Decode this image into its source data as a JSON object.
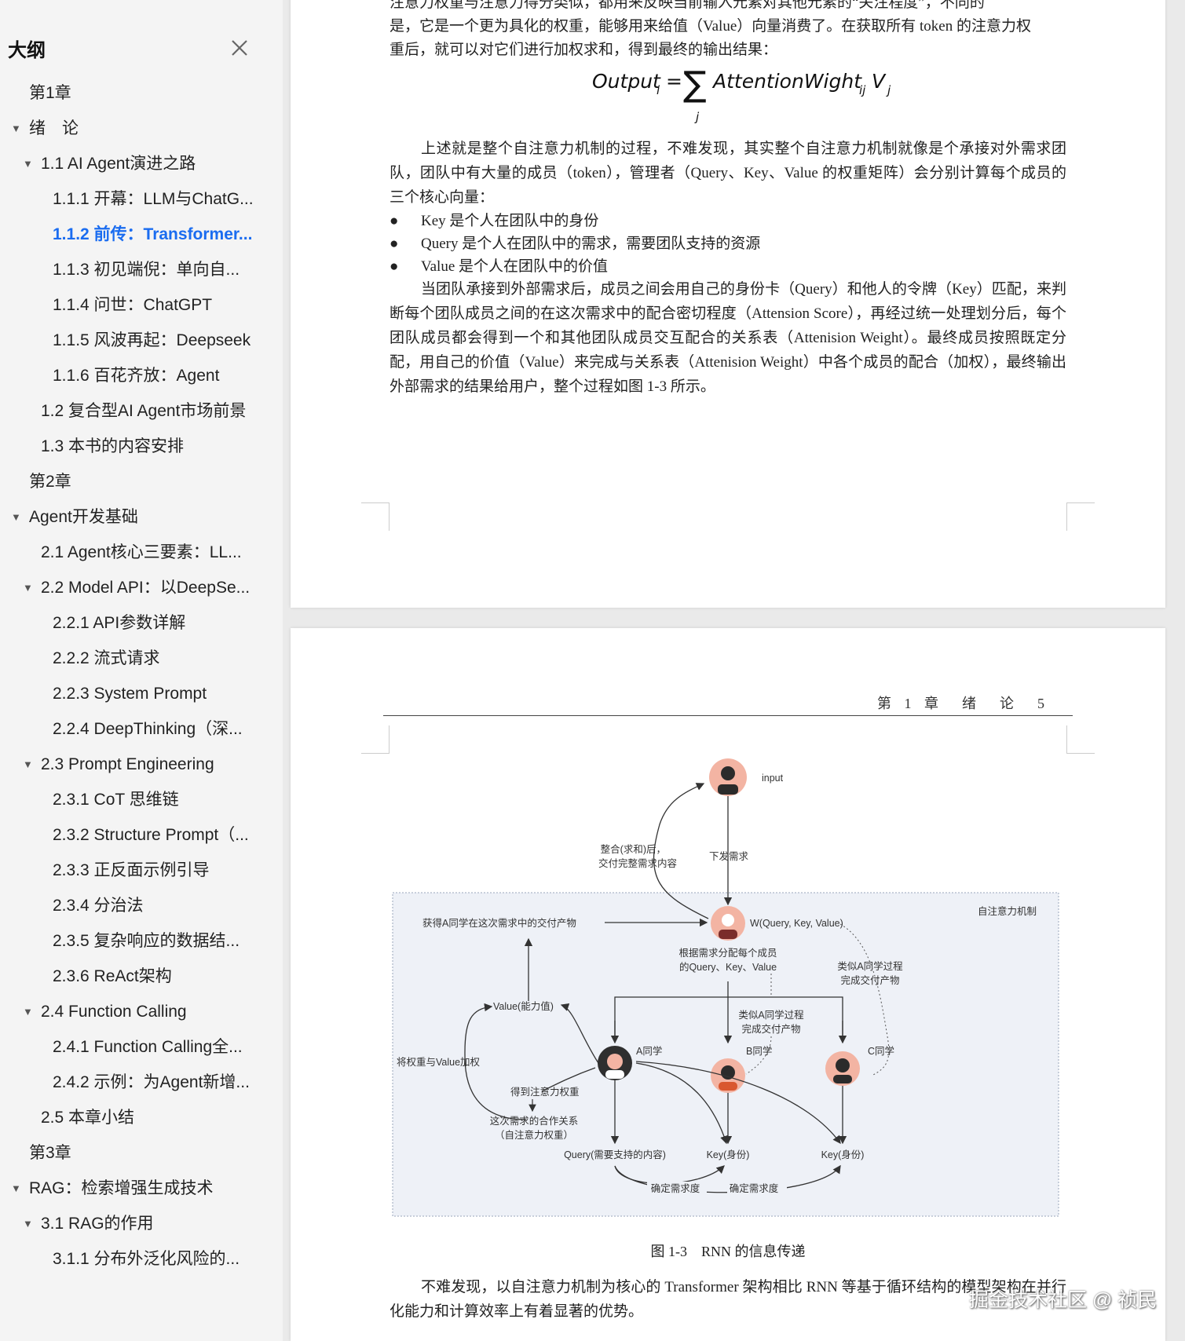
{
  "sidebar": {
    "title": "大纲",
    "items": [
      {
        "label": "第1章",
        "level": 1,
        "arrow": ""
      },
      {
        "label": "绪　论",
        "level": 1,
        "arrow": "▼"
      },
      {
        "label": "1.1  AI Agent演进之路",
        "level": 2,
        "arrow": "▼"
      },
      {
        "label": "1.1.1  开幕：LLM与ChatG...",
        "level": 3,
        "arrow": ""
      },
      {
        "label": "1.1.2  前传：Transformer...",
        "level": 3,
        "arrow": "",
        "active": true
      },
      {
        "label": "1.1.3  初见端倪：单向自...",
        "level": 3,
        "arrow": ""
      },
      {
        "label": "1.1.4  问世：ChatGPT",
        "level": 3,
        "arrow": ""
      },
      {
        "label": "1.1.5  风波再起：Deepseek",
        "level": 3,
        "arrow": ""
      },
      {
        "label": "1.1.6  百花齐放：Agent",
        "level": 3,
        "arrow": ""
      },
      {
        "label": "1.2  复合型AI Agent市场前景",
        "level": 2,
        "arrow": ""
      },
      {
        "label": "1.3  本书的内容安排",
        "level": 2,
        "arrow": ""
      },
      {
        "label": "第2章",
        "level": 1,
        "arrow": ""
      },
      {
        "label": "Agent开发基础",
        "level": 1,
        "arrow": "▼"
      },
      {
        "label": "2.1  Agent核心三要素：LL...",
        "level": 2,
        "arrow": ""
      },
      {
        "label": "2.2  Model API：以DeepSe...",
        "level": 2,
        "arrow": "▼"
      },
      {
        "label": "2.2.1  API参数详解",
        "level": 3,
        "arrow": ""
      },
      {
        "label": "2.2.2  流式请求",
        "level": 3,
        "arrow": ""
      },
      {
        "label": "2.2.3  System Prompt",
        "level": 3,
        "arrow": ""
      },
      {
        "label": "2.2.4  DeepThinking（深...",
        "level": 3,
        "arrow": ""
      },
      {
        "label": "2.3  Prompt Engineering",
        "level": 2,
        "arrow": "▼"
      },
      {
        "label": "2.3.1  CoT 思维链",
        "level": 3,
        "arrow": ""
      },
      {
        "label": "2.3.2  Structure Prompt（...",
        "level": 3,
        "arrow": ""
      },
      {
        "label": "2.3.3  正反面示例引导",
        "level": 3,
        "arrow": ""
      },
      {
        "label": "2.3.4  分治法",
        "level": 3,
        "arrow": ""
      },
      {
        "label": "2.3.5  复杂响应的数据结...",
        "level": 3,
        "arrow": ""
      },
      {
        "label": "2.3.6  ReAct架构",
        "level": 3,
        "arrow": ""
      },
      {
        "label": "2.4  Function Calling",
        "level": 2,
        "arrow": "▼"
      },
      {
        "label": "2.4.1  Function Calling全...",
        "level": 3,
        "arrow": ""
      },
      {
        "label": "2.4.2  示例：为Agent新增...",
        "level": 3,
        "arrow": ""
      },
      {
        "label": "2.5  本章小结",
        "level": 2,
        "arrow": ""
      },
      {
        "label": "第3章",
        "level": 1,
        "arrow": ""
      },
      {
        "label": "RAG：检索增强生成技术",
        "level": 1,
        "arrow": "▼"
      },
      {
        "label": "3.1  RAG的作用",
        "level": 2,
        "arrow": "▼"
      },
      {
        "label": "3.1.1  分布外泛化风险的...",
        "level": 3,
        "arrow": ""
      }
    ]
  },
  "page1": {
    "p_top_1": "注意力权重与注意力得分类似，都用来反映当前输入元素对其他元素的“关注程度”，不同的",
    "p_top_2": "是，它是一个更为具化的权重，能够用来给值（Value）向量消费了。在获取所有 token 的注意力权",
    "p_top_3": "重后，就可以对它们进行加权求和，得到最终的输出结果：",
    "formula": {
      "lhs": "Output",
      "lhs_sub": "i",
      "eq": "=",
      "sum": "∑",
      "sum_sub": "j",
      "rhs": "AttentionWight",
      "rhs_sub": "ij",
      "v": "V",
      "v_sub": "j"
    },
    "p_middle": "上述就是整个自注意力机制的过程，不难发现，其实整个自注意力机制就像是个承接对外需求团队，团队中有大量的成员（token），管理者（Query、Key、Value 的权重矩阵）会分别计算每个成员的三个核心向量：",
    "bullets": [
      "Key 是个人在团队中的身份",
      "Query 是个人在团队中的需求，需要团队支持的资源",
      "Value 是个人在团队中的价值"
    ],
    "p_last": "当团队承接到外部需求后，成员之间会用自己的身份卡（Query）和他人的令牌（Key）匹配，来判断每个团队成员之间的在这次需求中的配合密切程度（Attension Score），再经过统一处理划分后，每个团队成员都会得到一个和其他团队成员交互配合的关系表（Attenision Weight）。最终成员按照既定分配，用自己的价值（Value）来完成与关系表（Attenision Weight）中各个成员的配合（加权），最终输出外部需求的结果给用户，整个过程如图 1-3 所示。"
  },
  "page2": {
    "running_head": "第 1 章　绪　论　5",
    "figure_caption": "图 1-3　RNN 的信息传递",
    "p_bottom": "不难发现，以自注意力机制为核心的 Transformer 架构相比 RNN 等基于循环结构的模型架构在并行化能力和计算效率上有着显著的优势。"
  },
  "diagram": {
    "input": "input",
    "integrate_1": "整合(求和)后，",
    "integrate_2": "交付完整需求内容",
    "dispatch": "下发需求",
    "box_title": "自注意力机制",
    "get_a_output": "获得A同学在这次需求中的交付产物",
    "w_label": "W(Query, Key, Value)",
    "assign_1": "根据需求分配每个成员",
    "assign_2": "的Query、Key、Value",
    "similar_c_1": "类似A同学过程",
    "similar_c_2": "完成交付产物",
    "similar_b_1": "类似A同学过程",
    "similar_b_2": "完成交付产物",
    "value_label": "Value(能力值)",
    "weight_value": "将权重与Value加权",
    "student_a": "A同学",
    "student_b": "B同学",
    "student_c": "C同学",
    "get_weight": "得到注意力权重",
    "relation_1": "这次需求的合作关系",
    "relation_2": "（自注意力权重）",
    "query_label": "Query(需要支持的内容)",
    "key_b": "Key(身份)",
    "key_c": "Key(身份)",
    "confirm_1": "确定需求度",
    "confirm_2": "确定需求度"
  },
  "watermark": "掘金技术社区 @ 祯民"
}
